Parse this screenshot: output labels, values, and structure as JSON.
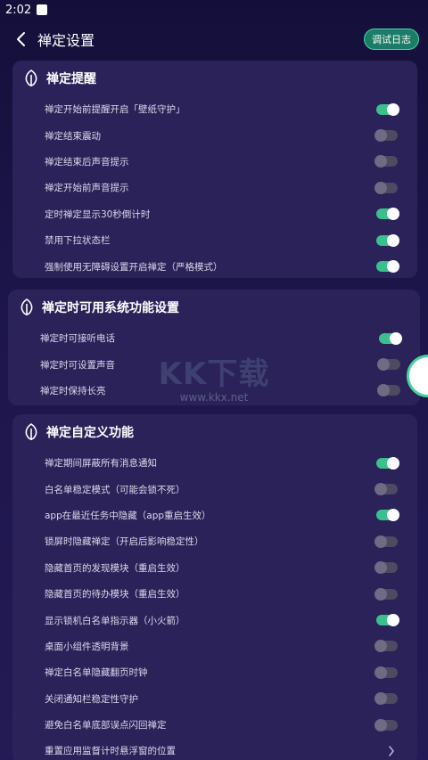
{
  "status": {
    "time": "2:02"
  },
  "header": {
    "title": "禅定设置",
    "debug_label": "调试日志"
  },
  "watermark": {
    "logo": "KK下载",
    "url": "www.kkx.net"
  },
  "sections": [
    {
      "title": "禅定提醒",
      "rows": [
        {
          "label": "禅定开始前提醒开启「壁纸守护」",
          "control": "toggle",
          "on": true
        },
        {
          "label": "禅定结束震动",
          "control": "toggle",
          "on": false
        },
        {
          "label": "禅定结束后声音提示",
          "control": "toggle",
          "on": false
        },
        {
          "label": "禅定开始前声音提示",
          "control": "toggle",
          "on": false
        },
        {
          "label": "定时禅定显示30秒倒计时",
          "control": "toggle",
          "on": true
        },
        {
          "label": "禁用下拉状态栏",
          "control": "toggle",
          "on": true
        },
        {
          "label": "强制使用无障碍设置开启禅定（严格模式）",
          "control": "toggle",
          "on": true
        }
      ]
    },
    {
      "title": "禅定时可用系统功能设置",
      "rows": [
        {
          "label": "禅定时可接听电话",
          "control": "toggle",
          "on": true
        },
        {
          "label": "禅定时可设置声音",
          "control": "toggle",
          "on": false
        },
        {
          "label": "禅定时保持长亮",
          "control": "toggle",
          "on": false
        }
      ]
    },
    {
      "title": "禅定自定义功能",
      "rows": [
        {
          "label": "禅定期间屏蔽所有消息通知",
          "control": "toggle",
          "on": true
        },
        {
          "label": "白名单稳定模式（可能会锁不死）",
          "control": "toggle",
          "on": false
        },
        {
          "label": "app在最近任务中隐藏（app重启生效）",
          "control": "toggle",
          "on": true
        },
        {
          "label": "锁屏时隐藏禅定（开启后影响稳定性）",
          "control": "toggle",
          "on": false
        },
        {
          "label": "隐藏首页的发现模块（重启生效）",
          "control": "toggle",
          "on": false
        },
        {
          "label": "隐藏首页的待办模块（重启生效）",
          "control": "toggle",
          "on": false
        },
        {
          "label": "显示锁机白名单指示器（小火箭）",
          "control": "toggle",
          "on": true
        },
        {
          "label": "桌面小组件透明背景",
          "control": "toggle",
          "on": false
        },
        {
          "label": "禅定白名单隐藏翻页时钟",
          "control": "toggle",
          "on": false
        },
        {
          "label": "关闭通知栏稳定性守护",
          "control": "toggle",
          "on": false
        },
        {
          "label": "避免白名单底部误点闪回禅定",
          "control": "toggle",
          "on": false
        },
        {
          "label": "重置应用监督计时悬浮窗的位置",
          "control": "chevron",
          "on": false
        }
      ]
    }
  ],
  "colors": {
    "accent": "#3bbf8f",
    "card": "#2a2258",
    "background": "#1a1446"
  }
}
